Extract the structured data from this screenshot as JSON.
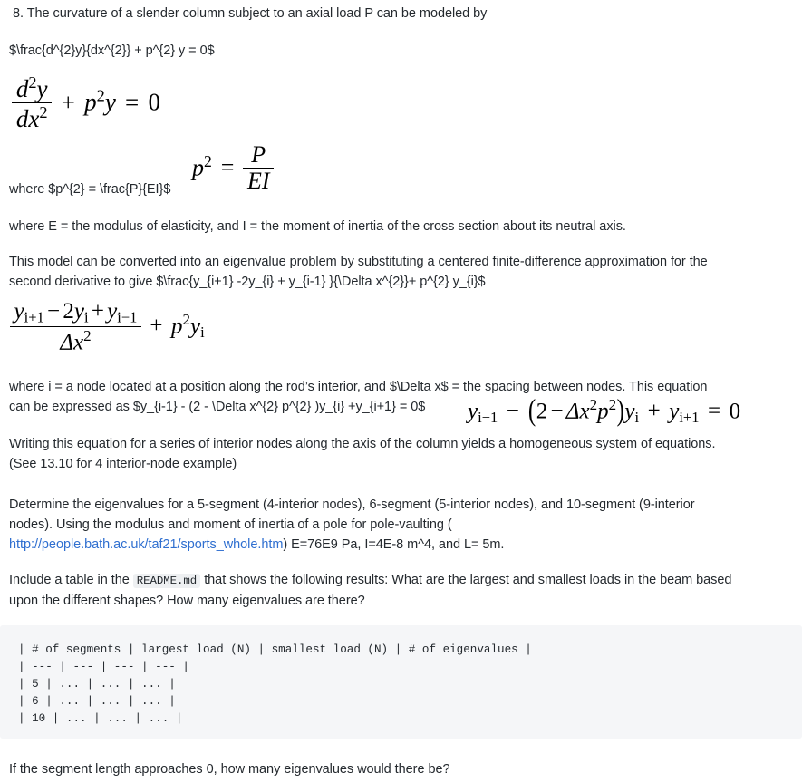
{
  "document": {
    "question_number": "8.",
    "intro": "8. The curvature of a slender column subject to an axial load P can be modeled by",
    "latex_source_1": "$\\frac{d^{2}y}{dx^{2}} + p^{2} y = 0$",
    "where_p_source": "where $p^{2} = \\frac{P}{EI}$",
    "where_EI": "where E = the modulus of elasticity, and I = the moment of inertia of the cross section about its neutral axis.",
    "eigen_intro_line1": "This model can be converted into an eigenvalue problem by substituting a centered finite-difference approximation for the",
    "eigen_intro_line2": "second derivative to give $\\frac{y_{i+1} -2y_{i} + y_{i-1} }{\\Delta x^{2}}+ p^{2} y_{i}$",
    "node_def_line1": "where i = a node located at a position along the rod’s interior, and $\\Delta x$ = the spacing between nodes. This equation",
    "node_def_line2": "can be expressed as $y_{i-1} - (2 - \\Delta x^{2} p^{2} )y_{i} +y_{i+1} = 0$",
    "writing_line1": "Writing this equation for a series of interior nodes along the axis of the column yields a homogeneous system of equations.",
    "writing_line2": "(See 13.10 for 4 interior-node example)",
    "determine_line1": "Determine the eigenvalues for a 5-segment (4-interior nodes), 6-segment (5-interior nodes), and 10-segment (9-interior",
    "determine_line2": "nodes). Using the modulus and moment of inertia of a pole for pole-vaulting (",
    "link_text": "http://people.bath.ac.uk/taf21/sports_whole.htm",
    "determine_after_link": ") E=76E9 Pa, I=4E-8 m^4, and L= 5m.",
    "include_table_before": "Include a table in the",
    "include_table_code": "README.md",
    "include_table_after_line1": "that shows the following results: What are the largest and smallest loads in the beam based",
    "include_table_after_line2": "upon the different shapes? How many eigenvalues are there?",
    "closing_question": "If the segment length approaches 0, how many eigenvalues would there be?"
  },
  "equations": {
    "ode": {
      "numerator": "d",
      "numerator_sup": "2",
      "numerator_var": "y",
      "denominator": "dx",
      "denominator_sup": "2",
      "plus": "+",
      "p": "p",
      "p_sup": "2",
      "y": "y",
      "equals": "=",
      "zero": "0"
    },
    "p_squared": {
      "p": "p",
      "p_sup": "2",
      "equals": "=",
      "numerator": "P",
      "denominator": "EI"
    },
    "finite_difference": {
      "y1": "y",
      "y1_sub": "i+1",
      "minus": "−",
      "two": "2",
      "y2": "y",
      "y2_sub": "i",
      "plus": "+",
      "y3": "y",
      "y3_sub": "i−1",
      "denominator_delta": "Δx",
      "denominator_sup": "2",
      "tail_plus": "+",
      "tail_p": "p",
      "tail_p_sup": "2",
      "tail_y": "y",
      "tail_y_sub": "i"
    },
    "expanded": {
      "y1": "y",
      "y1_sub": "i−1",
      "minus1": "−",
      "open": "(",
      "two": "2",
      "minus2": "−",
      "delta": "Δx",
      "delta_sup": "2",
      "p": "p",
      "p_sup": "2",
      "close": ")",
      "y2": "y",
      "y2_sub": "i",
      "plus": "+",
      "y3": "y",
      "y3_sub": "i+1",
      "equals": "=",
      "zero": "0"
    }
  },
  "code_block": {
    "language": "markdown",
    "lines": [
      "| # of segments | largest load (N) | smallest load (N) | # of eigenvalues |",
      "| --- | --- | --- | --- |",
      "| 5 | ... | ... | ... |",
      "| 6 | ... | ... | ... |",
      "| 10 | ... | ... | ... |"
    ],
    "table_headers": [
      "# of segments",
      "largest load (N)",
      "smallest load (N)",
      "# of eigenvalues"
    ],
    "table_rows": [
      [
        "5",
        "...",
        "...",
        "..."
      ],
      [
        "6",
        "...",
        "...",
        "..."
      ],
      [
        "10",
        "...",
        "...",
        "..."
      ]
    ]
  },
  "colors": {
    "text": "#24292e",
    "link": "#2f6fd0",
    "code_background": "#f5f6f8",
    "inline_code_background": "#eef0f2",
    "page_background": "#ffffff"
  }
}
